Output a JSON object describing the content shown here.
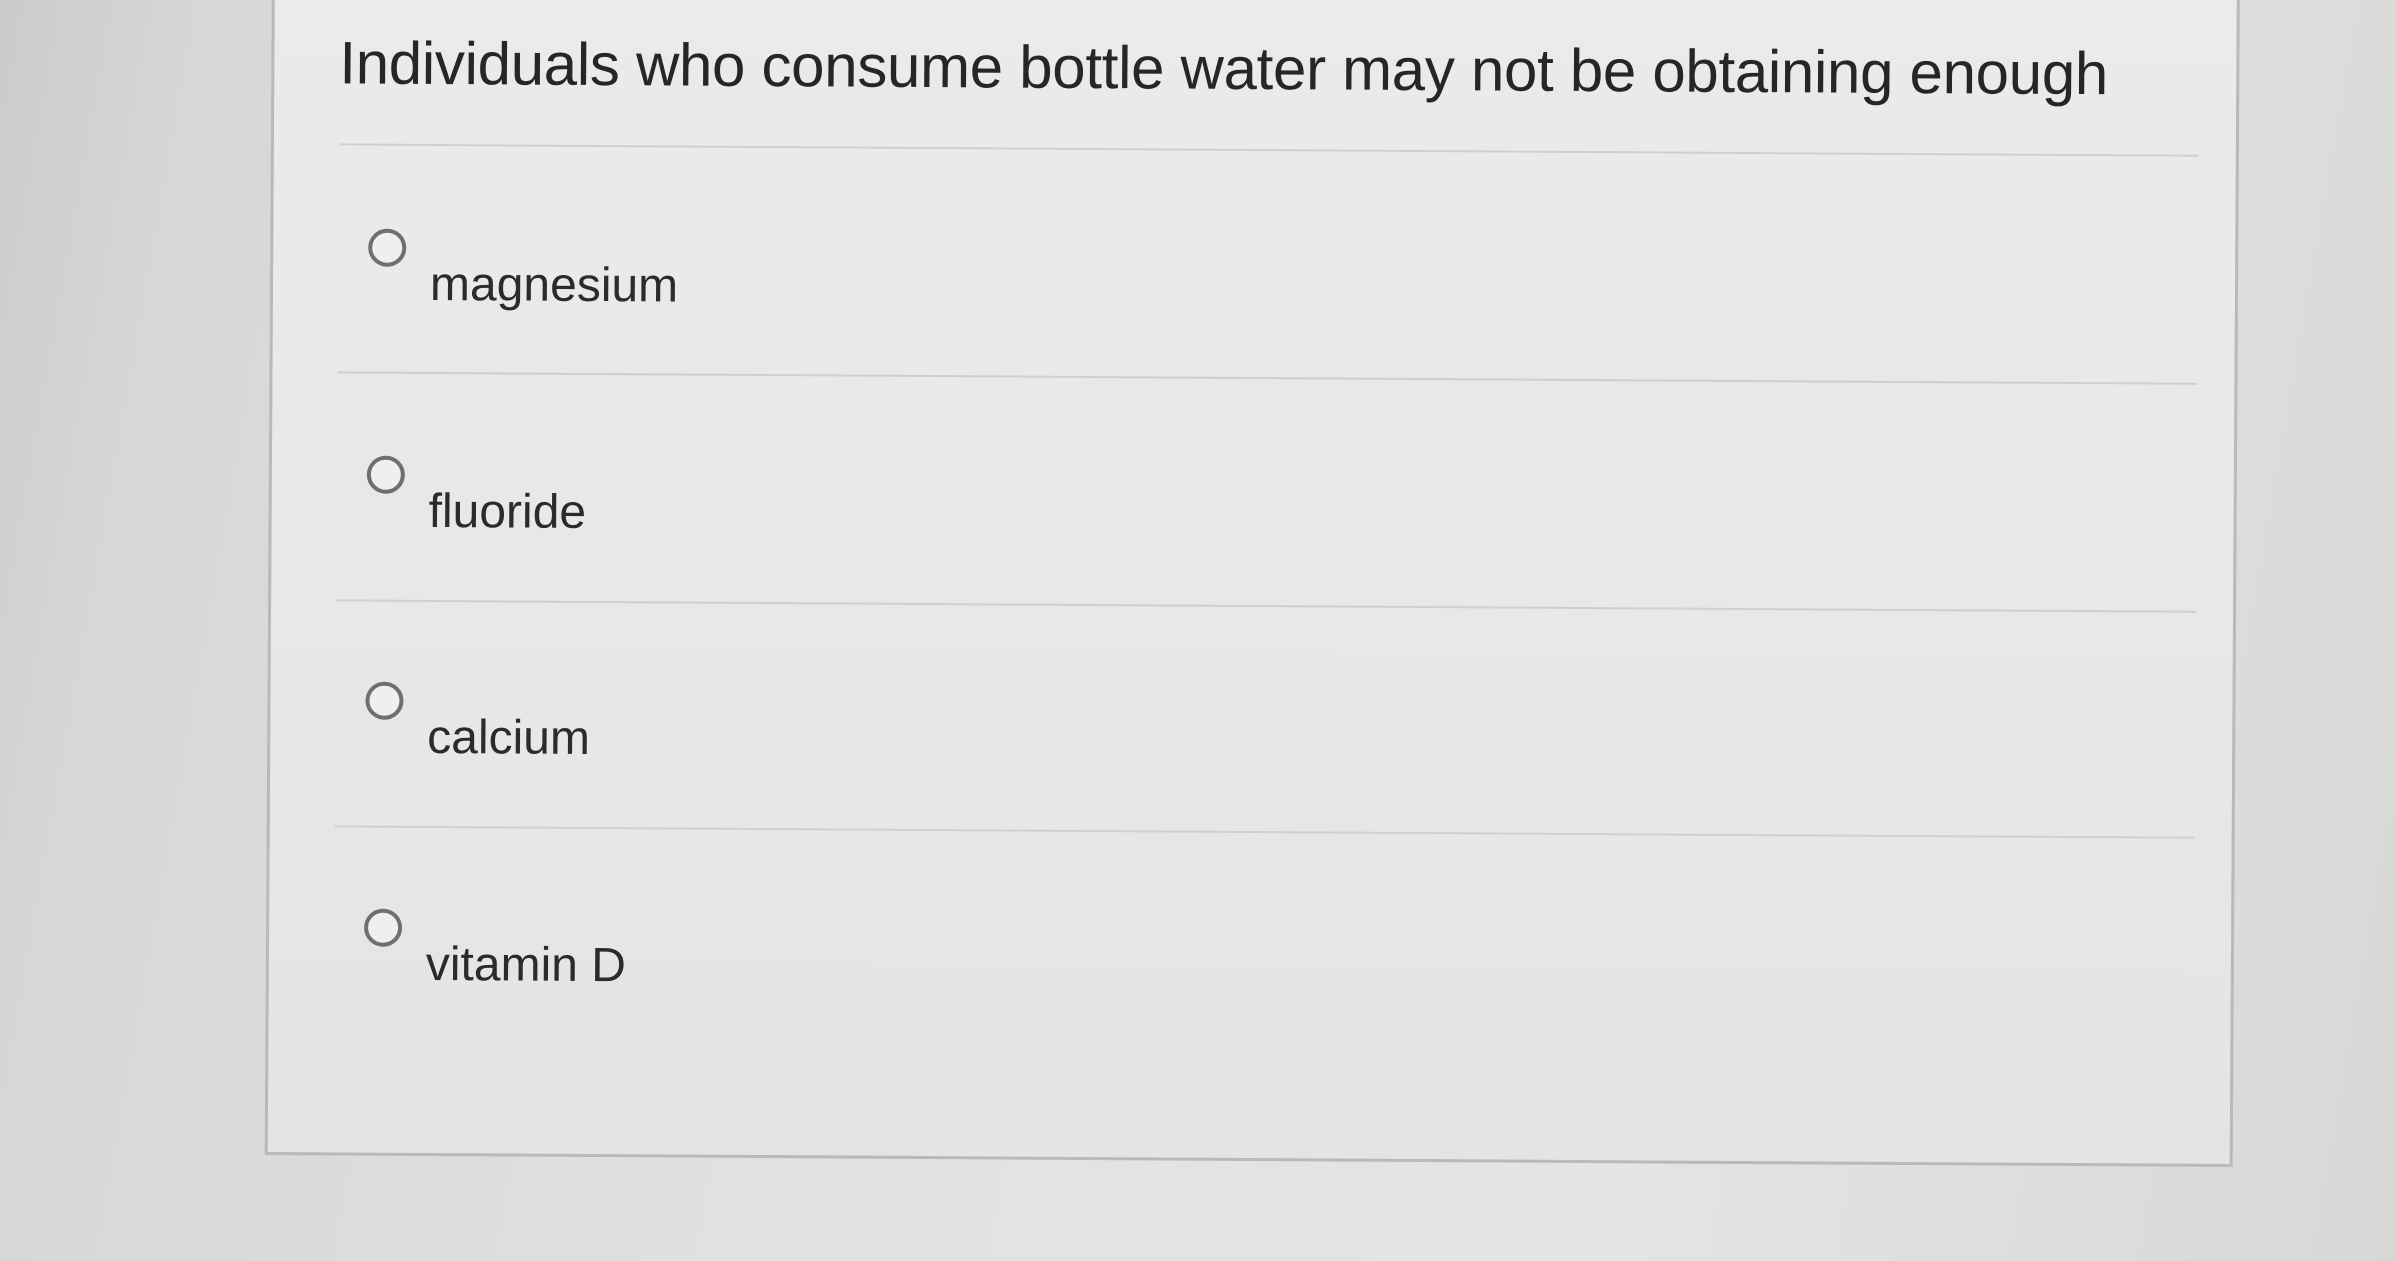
{
  "question": {
    "text": "Individuals who consume bottle water may not be obtaining enough"
  },
  "options": [
    {
      "label": "magnesium",
      "selected": false
    },
    {
      "label": "fluoride",
      "selected": false
    },
    {
      "label": "calcium",
      "selected": false
    },
    {
      "label": "vitamin D",
      "selected": false
    }
  ]
}
